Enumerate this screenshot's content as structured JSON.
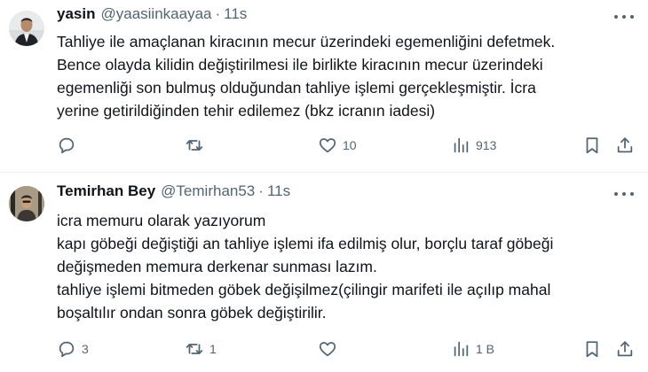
{
  "tweets": [
    {
      "name": "yasin",
      "handle": "@yaasiinkaayaa",
      "separator": "·",
      "time": "11s",
      "text_lines": [
        "Tahliye ile amaçlanan kiracının mecur üzerindeki egemenliğini defetmek.",
        "Bence olayda kilidin değiştirilmesi ile birlikte kiracının mecur üzerindeki",
        "egemenliği son bulmuş olduğundan tahliye işlemi gerçekleşmiştir. İcra",
        "yerine getirildiğinden tehir edilemez (bkz icranın iadesi)"
      ],
      "replies": "",
      "retweets": "",
      "likes": "10",
      "views": "913"
    },
    {
      "name": "Temirhan Bey",
      "handle": "@Temirhan53",
      "separator": "·",
      "time": "11s",
      "text_lines": [
        "icra memuru olarak yazıyorum",
        "kapı göbeği değiştiği an tahliye işlemi ifa edilmiş olur, borçlu taraf göbeği",
        "değişmeden memura derkenar sunması lazım.",
        "tahliye işlemi bitmeden göbek değişilmez(çilingir marifeti ile açılıp mahal",
        "boşaltılır ondan sonra göbek değiştirilir."
      ],
      "replies": "3",
      "retweets": "1",
      "likes": "",
      "views": "1 B"
    }
  ],
  "icons": {
    "more": "more-dots-icon",
    "reply": "reply-bubble-icon",
    "retweet": "retweet-arrows-icon",
    "like": "heart-icon",
    "views": "views-bar-chart-icon",
    "bookmark": "bookmark-icon",
    "share": "share-upload-icon"
  },
  "colors": {
    "text": "#0f1419",
    "secondary": "#536471",
    "divider": "#eff3f4"
  }
}
